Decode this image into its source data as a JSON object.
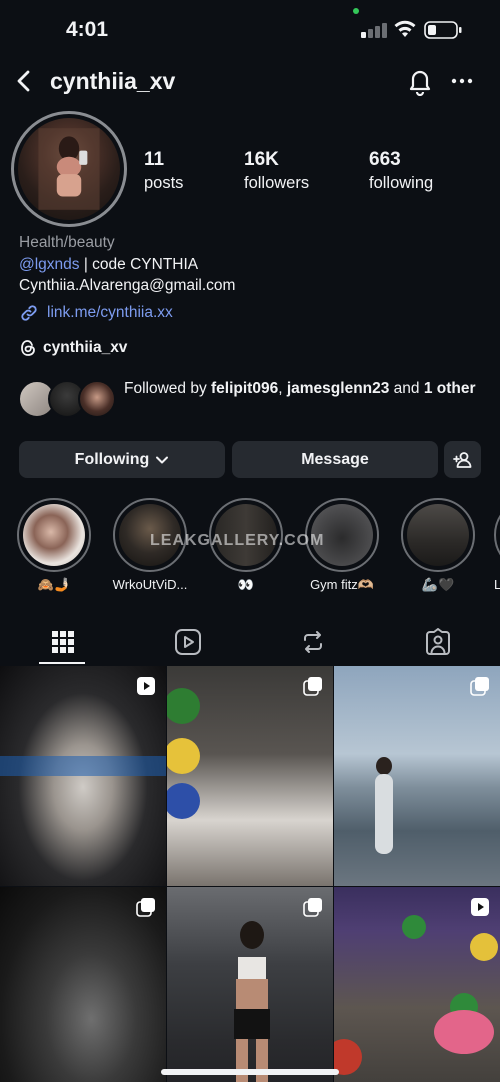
{
  "status_bar": {
    "time": "4:01"
  },
  "header": {
    "username": "cynthiia_xv",
    "icons": [
      "back-icon",
      "bell-icon",
      "more-icon"
    ]
  },
  "stats": [
    {
      "value": "11",
      "label": "posts"
    },
    {
      "value": "16K",
      "label": "followers"
    },
    {
      "value": "663",
      "label": "following"
    }
  ],
  "bio": {
    "category": "Health/beauty",
    "mention": "@lgxnds",
    "line1_rest": " | code CYNTHIA",
    "email": "Cynthiia.Alvarenga@gmail.com",
    "link": "link.me/cynthiia.xx",
    "threads_handle": "cynthiia_xv"
  },
  "followed_by": {
    "prefix": "Followed by ",
    "user1": "felipit096",
    "sep": ", ",
    "user2": "jamesglenn23",
    "and": " and ",
    "other": "1 other"
  },
  "buttons": {
    "following": "Following",
    "message": "Message"
  },
  "highlights": [
    {
      "label": "🙈🤳🏻"
    },
    {
      "label": "WrkoUtViD..."
    },
    {
      "label": "👀"
    },
    {
      "label": "Gym fitz🫶🏼"
    },
    {
      "label": "🦾🖤"
    },
    {
      "label": "L"
    }
  ],
  "watermark": "LEAKGALLERY.COM",
  "tabs": [
    "grid-icon",
    "reels-icon",
    "tagged-repost-icon",
    "tagged-icon"
  ],
  "grid_badges": [
    "reel",
    "carousel",
    "carousel",
    "carousel",
    "carousel",
    "reel"
  ],
  "colors": {
    "background": "#0c0f14",
    "link": "#7d9cf0",
    "button": "#262a30"
  }
}
